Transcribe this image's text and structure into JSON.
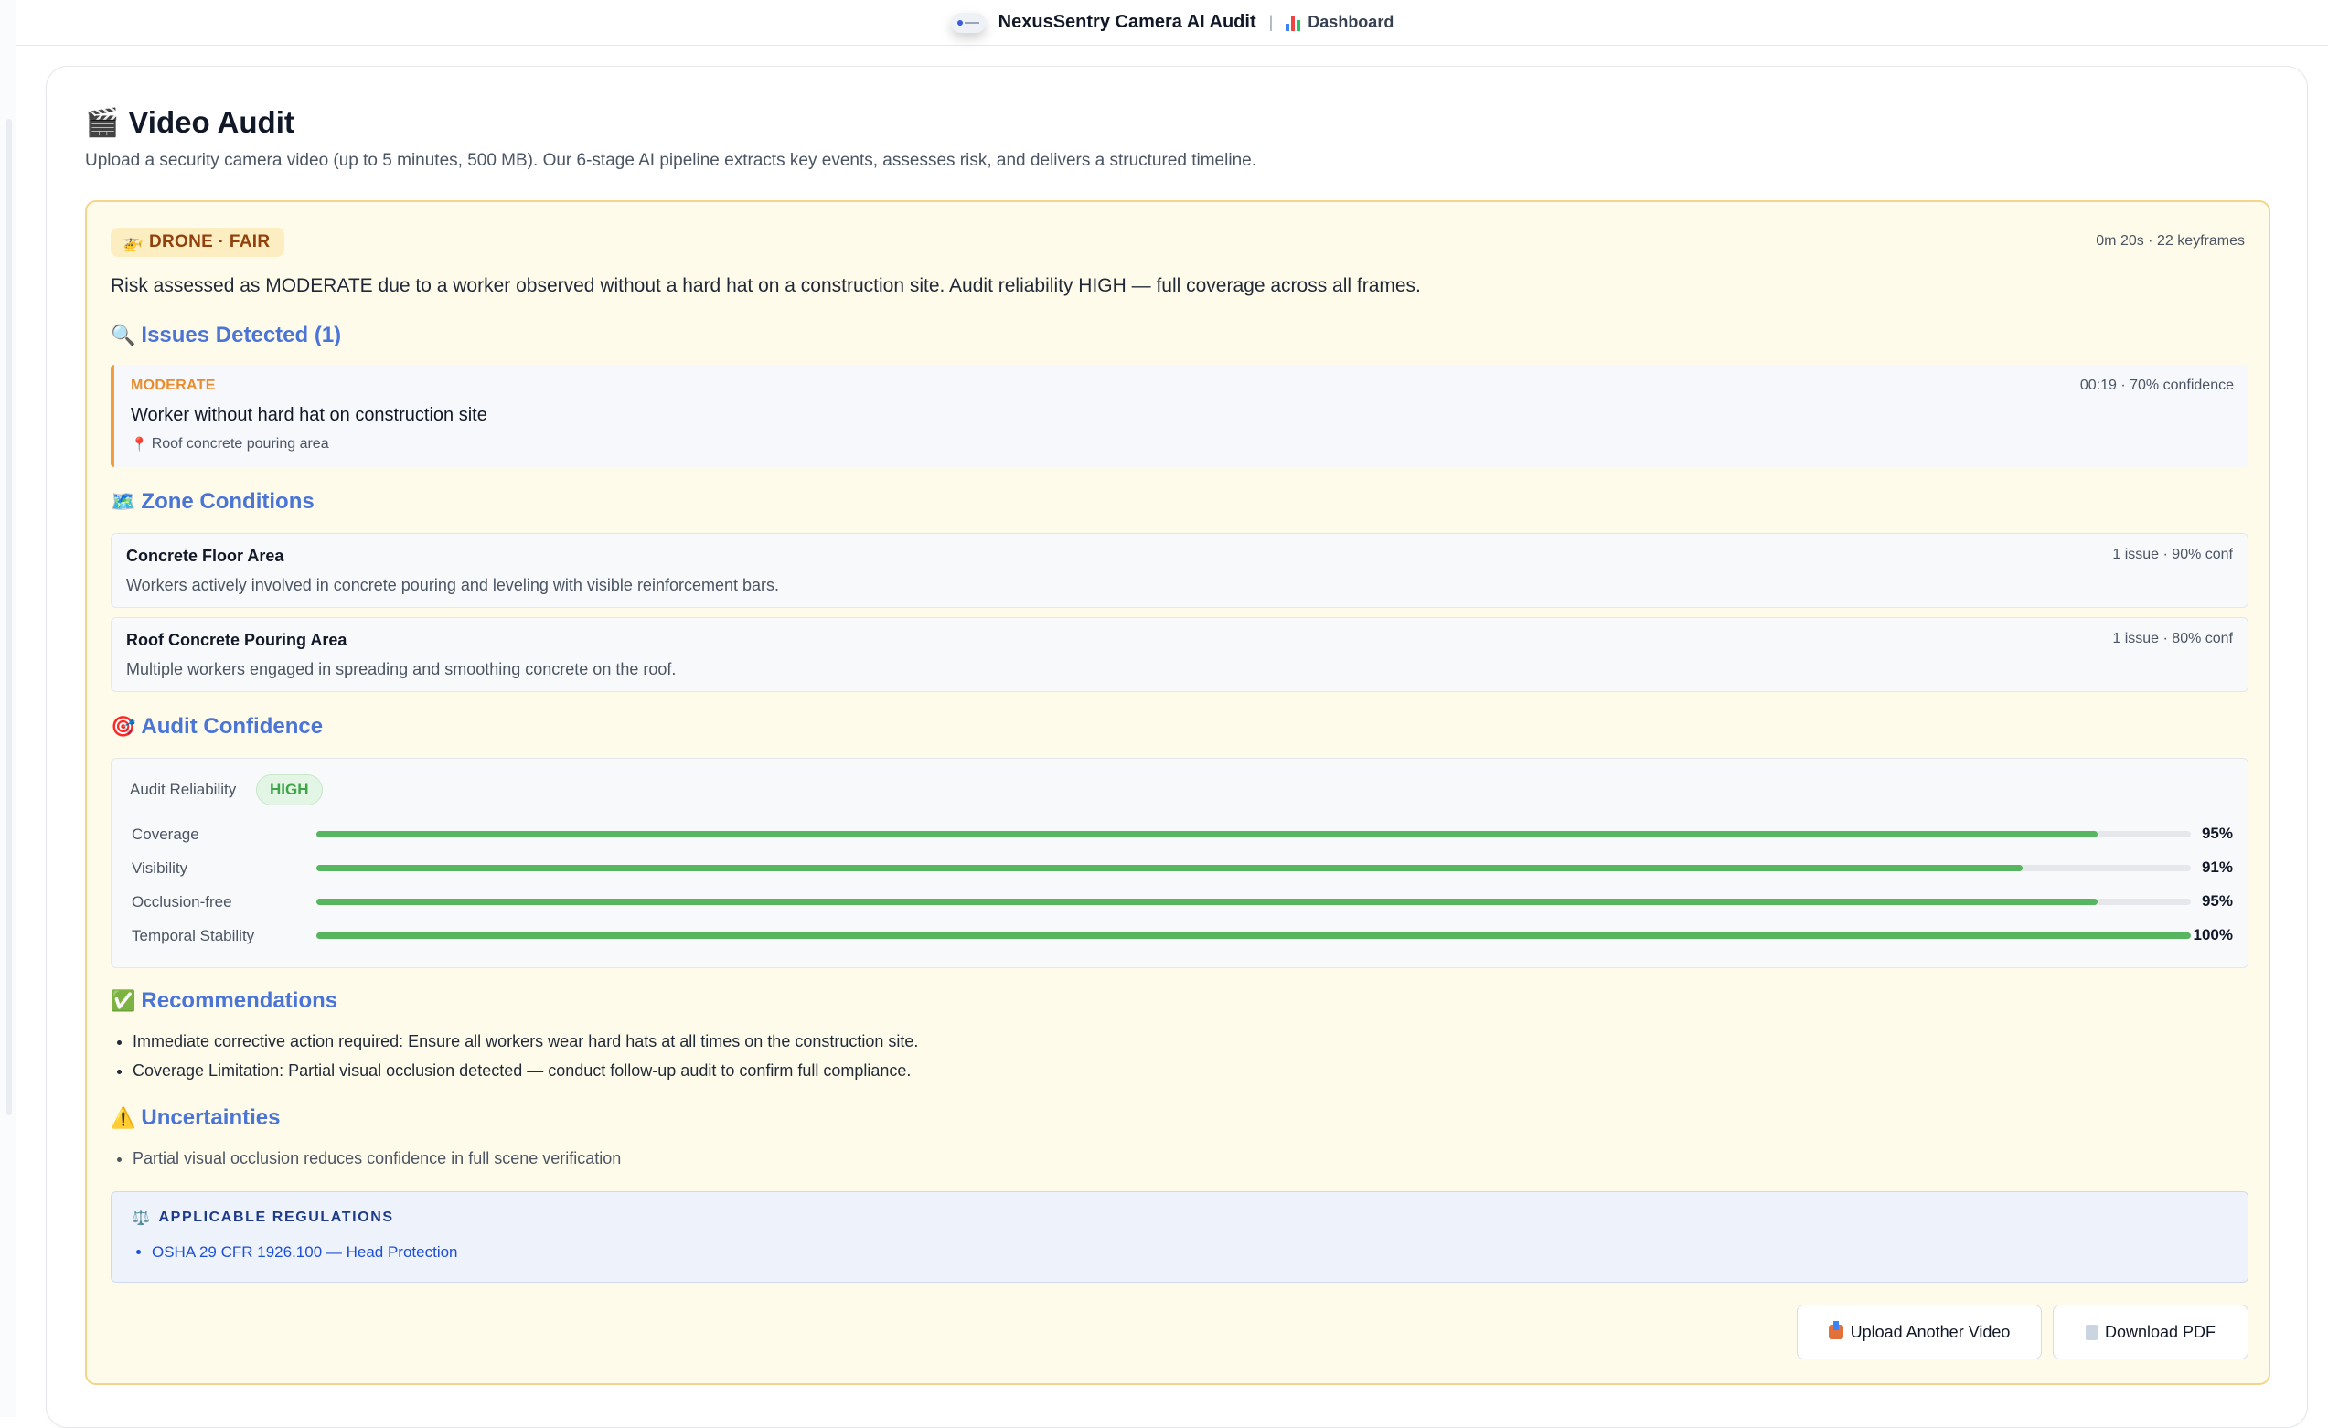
{
  "header": {
    "app_title": "NexusSentry Camera AI Audit",
    "separator": "|",
    "dashboard_label": "Dashboard"
  },
  "page": {
    "title": "Video Audit",
    "description": "Upload a security camera video (up to 5 minutes, 500 MB). Our 6-stage AI pipeline extracts key events, assesses risk, and delivers a structured timeline."
  },
  "result": {
    "badge": "DRONE · FAIR",
    "meta": "0m 20s · 22 keyframes",
    "summary": "Risk assessed as MODERATE due to a worker observed without a hard hat on a construction site. Audit reliability HIGH — full coverage across all frames.",
    "accent_color": "#f3d48a"
  },
  "issues": {
    "title": "Issues Detected (1)",
    "items": [
      {
        "severity": "MODERATE",
        "meta": "00:19 · 70% confidence",
        "text": "Worker without hard hat on construction site",
        "location": "Roof concrete pouring area"
      }
    ]
  },
  "zones": {
    "title": "Zone Conditions",
    "items": [
      {
        "name": "Concrete Floor Area",
        "meta": "1 issue · 90% conf",
        "description": "Workers actively involved in concrete pouring and leveling with visible reinforcement bars."
      },
      {
        "name": "Roof Concrete Pouring Area",
        "meta": "1 issue · 80% conf",
        "description": "Multiple workers engaged in spreading and smoothing concrete on the roof."
      }
    ]
  },
  "confidence": {
    "title": "Audit Confidence",
    "reliability_label": "Audit Reliability",
    "reliability_value": "HIGH",
    "metrics": [
      {
        "label": "Coverage",
        "value": 95,
        "display": "95%"
      },
      {
        "label": "Visibility",
        "value": 91,
        "display": "91%"
      },
      {
        "label": "Occlusion-free",
        "value": 95,
        "display": "95%"
      },
      {
        "label": "Temporal Stability",
        "value": 100,
        "display": "100%"
      }
    ],
    "bar_color": "#58b55f"
  },
  "recommendations": {
    "title": "Recommendations",
    "items": [
      "Immediate corrective action required: Ensure all workers wear hard hats at all times on the construction site.",
      "Coverage Limitation: Partial visual occlusion detected — conduct follow-up audit to confirm full compliance."
    ]
  },
  "uncertainties": {
    "title": "Uncertainties",
    "items": [
      "Partial visual occlusion reduces confidence in full scene verification"
    ]
  },
  "regulations": {
    "title": "APPLICABLE REGULATIONS",
    "items": [
      "OSHA 29 CFR 1926.100 — Head Protection"
    ]
  },
  "actions": {
    "upload_label": "Upload Another Video",
    "pdf_label": "Download PDF"
  },
  "icons": {
    "logo": "nexussentry-logo-icon",
    "dashboard": "bar-chart-icon",
    "title": "clapper-board-icon",
    "drone": "helicopter-icon",
    "issues": "magnifier-icon",
    "zones": "map-icon",
    "confidence": "target-icon",
    "recommendations": "check-box-icon",
    "uncertainties": "warning-icon",
    "location": "pin-icon",
    "regulations": "scales-icon",
    "upload": "upload-tray-icon",
    "pdf": "document-icon"
  }
}
